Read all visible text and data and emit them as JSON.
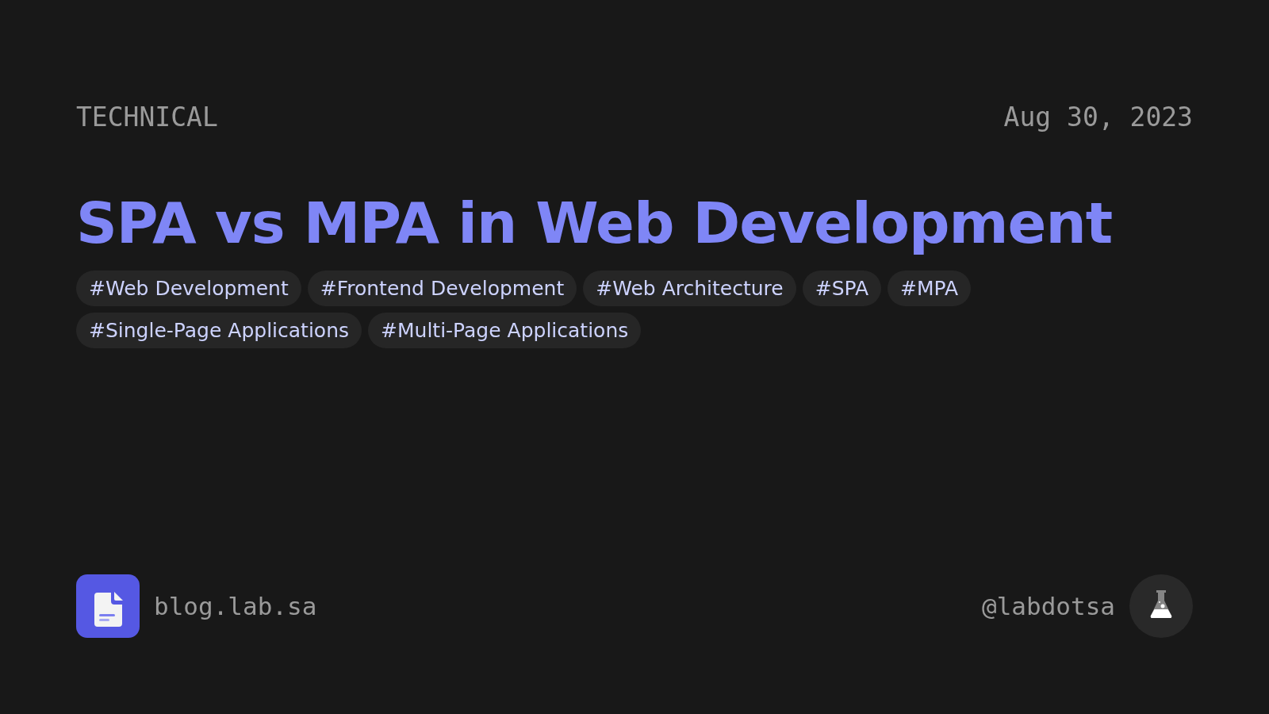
{
  "category": "TECHNICAL",
  "date": "Aug 30, 2023",
  "title": "SPA vs MPA in Web Development",
  "tag_rows": [
    [
      "#Web Development",
      "#Frontend Development",
      "#Web Architecture",
      "#SPA",
      "#MPA"
    ],
    [
      "#Single-Page Applications",
      "#Multi-Page Applications"
    ]
  ],
  "site": "blog.lab.sa",
  "handle": "@labdotsa"
}
